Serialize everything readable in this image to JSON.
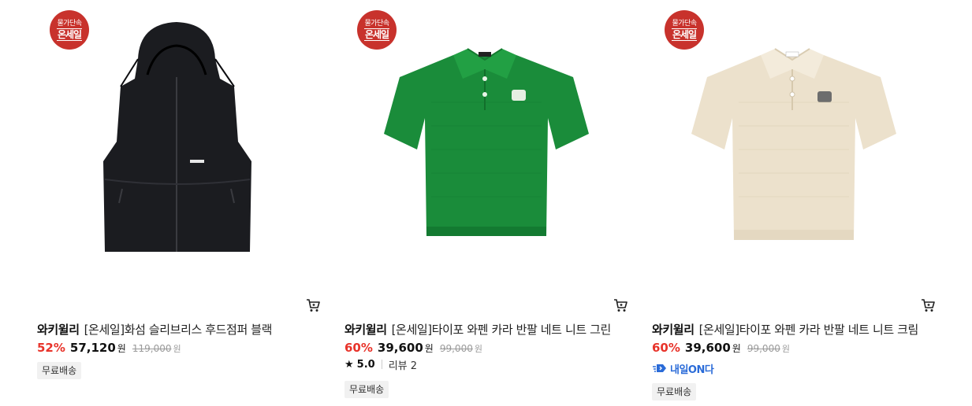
{
  "colors": {
    "discount": "#e8332a",
    "badge": "#c8322c",
    "tomorrow": "#2a6bd8"
  },
  "products": [
    {
      "badge_top": "물가단속",
      "badge_main": "온세일",
      "brand": "와키윌리",
      "name": "[온세일]화섬 슬리브리스 후드점퍼 블랙",
      "discount": "52%",
      "price": "57,120",
      "currency": "원",
      "original_price": "119,000",
      "delivery": "무료배송",
      "icon": "cart-icon"
    },
    {
      "badge_top": "물가단속",
      "badge_main": "온세일",
      "brand": "와키윌리",
      "name": "[온세일]타이포 와펜 카라 반팔 네트 니트 그린",
      "discount": "60%",
      "price": "39,600",
      "currency": "원",
      "original_price": "99,000",
      "rating": "5.0",
      "review": "리뷰 2",
      "delivery": "무료배송",
      "icon": "cart-icon"
    },
    {
      "badge_top": "물가단속",
      "badge_main": "온세일",
      "brand": "와키윌리",
      "name": "[온세일]타이포 와펜 카라 반팔 네트 니트 크림",
      "discount": "60%",
      "price": "39,600",
      "currency": "원",
      "original_price": "99,000",
      "tomorrow_label": "내일ON다",
      "delivery": "무료배송",
      "icon": "cart-icon"
    }
  ]
}
